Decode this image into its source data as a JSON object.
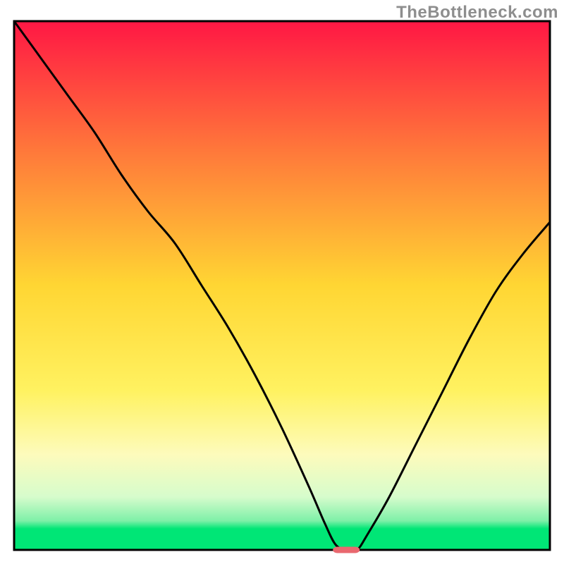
{
  "watermark": "TheBottleneck.com",
  "colors": {
    "curve_stroke": "#000000",
    "axis_stroke": "#000000",
    "marker_fill": "#e9686f",
    "gradient_stops": [
      {
        "offset": 0.0,
        "color": "#ff1744"
      },
      {
        "offset": 0.25,
        "color": "#ff7a3a"
      },
      {
        "offset": 0.5,
        "color": "#ffd633"
      },
      {
        "offset": 0.7,
        "color": "#fff261"
      },
      {
        "offset": 0.82,
        "color": "#fdfbbc"
      },
      {
        "offset": 0.9,
        "color": "#d6fccc"
      },
      {
        "offset": 0.945,
        "color": "#7ef0a8"
      },
      {
        "offset": 0.96,
        "color": "#00e676"
      },
      {
        "offset": 1.0,
        "color": "#00e676"
      }
    ]
  },
  "chart_data": {
    "type": "line",
    "title": "",
    "xlabel": "",
    "ylabel": "",
    "xlim": [
      0,
      100
    ],
    "ylim": [
      0,
      100
    ],
    "grid": false,
    "legend": false,
    "optimum_x": 62,
    "marker": {
      "x": 62,
      "y": 0,
      "width": 5,
      "height": 1.2
    },
    "x": [
      0,
      5,
      10,
      15,
      20,
      25,
      30,
      35,
      40,
      45,
      50,
      55,
      58,
      60,
      62,
      64,
      66,
      70,
      75,
      80,
      85,
      90,
      95,
      100
    ],
    "values": [
      100,
      93,
      86,
      79,
      71,
      64,
      58,
      50,
      42,
      33,
      23,
      12,
      5,
      1,
      0,
      0,
      3,
      10,
      20,
      30,
      40,
      49,
      56,
      62
    ]
  }
}
